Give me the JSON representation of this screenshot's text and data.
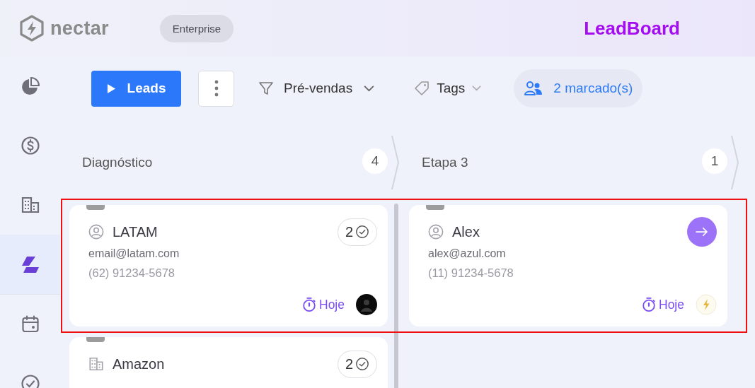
{
  "header": {
    "logo_text": "nectar",
    "plan_badge": "Enterprise",
    "title": "LeadBoard"
  },
  "sidebar": {
    "items": [
      {
        "kind": "pie",
        "selected": false
      },
      {
        "kind": "dollar",
        "selected": false
      },
      {
        "kind": "building",
        "selected": false
      },
      {
        "kind": "board",
        "selected": true
      },
      {
        "kind": "calendar",
        "selected": false
      },
      {
        "kind": "check",
        "selected": false
      }
    ]
  },
  "toolbar": {
    "leads_button": "Leads",
    "pipeline_filter": "Pré-vendas",
    "tags_filter": "Tags",
    "marked_filter": "2 marcado(s)"
  },
  "columns": [
    {
      "title": "Diagnóstico",
      "count": "4",
      "cards": [
        {
          "kind": "person",
          "name": "LATAM",
          "email": "email@latam.com",
          "phone": "(62) 91234-5678",
          "action": {
            "kind": "tasks",
            "count": "2"
          },
          "due": "Hoje",
          "avatar": {
            "kind": "dark"
          }
        },
        {
          "kind": "company",
          "name": "Amazon",
          "action": {
            "kind": "tasks",
            "count": "2"
          }
        }
      ]
    },
    {
      "title": "Etapa 3",
      "count": "1",
      "cards": [
        {
          "kind": "person",
          "name": "Alex",
          "email": "alex@azul.com",
          "phone": "(11) 91234-5678",
          "action": {
            "kind": "open"
          },
          "due": "Hoje",
          "avatar": {
            "kind": "logo"
          }
        }
      ]
    }
  ]
}
